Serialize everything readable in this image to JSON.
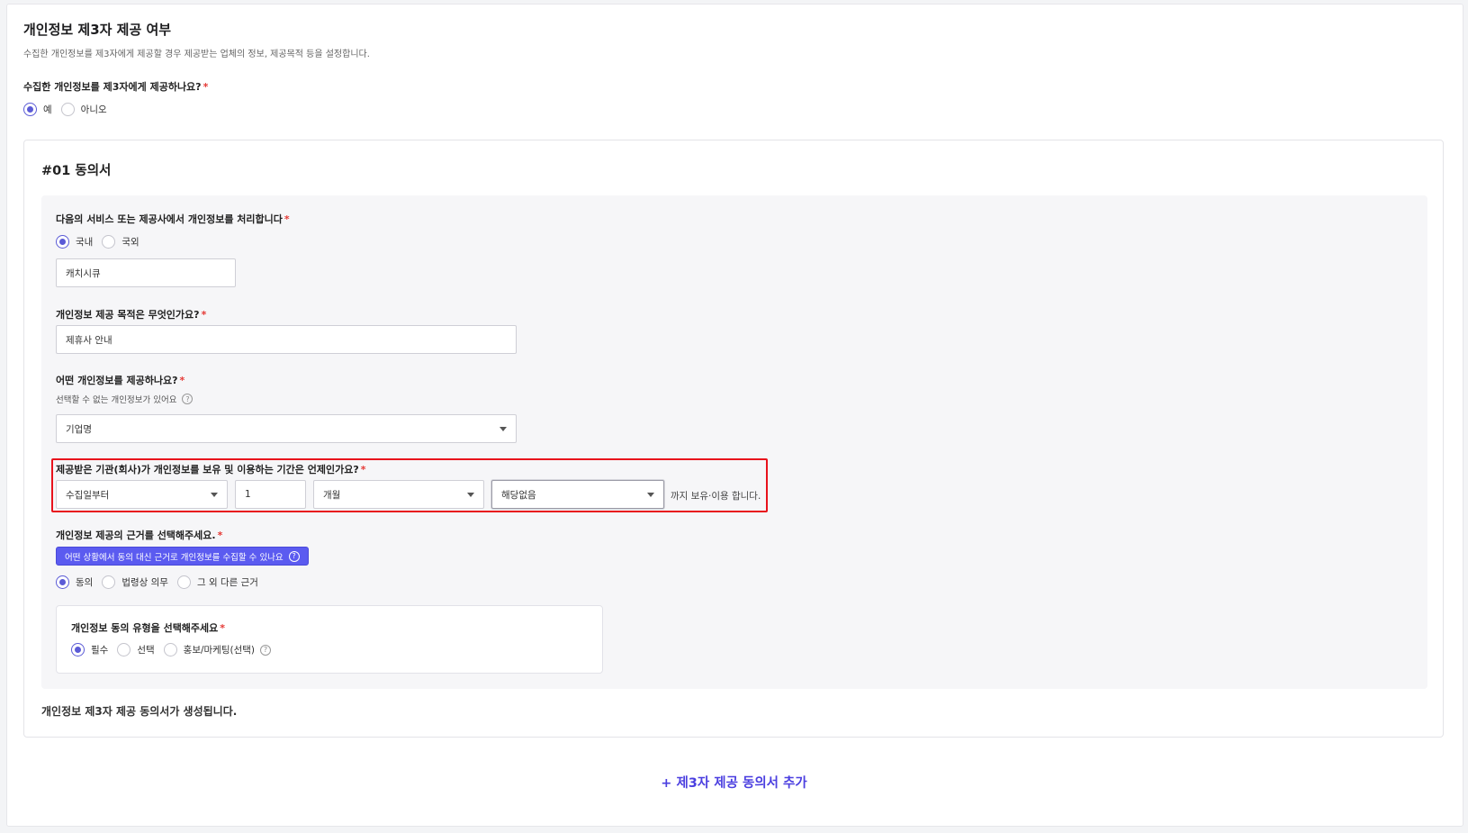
{
  "section": {
    "title": "개인정보 제3자 제공 여부",
    "description": "수집한 개인정보를 제3자에게 제공할 경우 제공받는 업체의 정보, 제공목적 등을 설정합니다."
  },
  "provide_question": {
    "label": "수집한 개인정보를 제3자에게 제공하나요?",
    "required_mark": "*",
    "options": [
      "예",
      "아니오"
    ],
    "selected": "예"
  },
  "consent": {
    "title": "#01 동의서",
    "processor": {
      "label": "다음의 서비스 또는 제공사에서 개인정보를 처리합니다",
      "required_mark": "*",
      "options": [
        "국내",
        "국외"
      ],
      "selected": "국내",
      "value": "캐치시큐"
    },
    "purpose": {
      "label": "개인정보 제공 목적은 무엇인가요?",
      "required_mark": "*",
      "value": "제휴사 안내"
    },
    "items": {
      "label": "어떤 개인정보를 제공하나요?",
      "required_mark": "*",
      "hint": "선택할 수 없는 개인정보가 있어요",
      "hint_icon": "question-circle-icon",
      "value": "기업명"
    },
    "retention": {
      "label": "제공받은 기관(회사)가 개인정보를 보유 및 이용하는 기간은 언제인가요?",
      "required_mark": "*",
      "start": "수집일부터",
      "amount": "1",
      "unit": "개월",
      "exception": "해당없음",
      "suffix": "까지 보유·이용 합니다.",
      "highlight_color": "#e8121c"
    },
    "basis": {
      "label": "개인정보 제공의 근거를 선택해주세요.",
      "required_mark": "*",
      "badge": "어떤 상황에서 동의 대신 근거로 개인정보를 수집할 수 있나요",
      "badge_icon": "question-circle-icon",
      "options": [
        "동의",
        "법령상 의무",
        "그 외 다른 근거"
      ],
      "selected": "동의"
    },
    "consent_type": {
      "label": "개인정보 동의 유형을 선택해주세요",
      "required_mark": "*",
      "options": [
        "필수",
        "선택",
        "홍보/마케팅(선택)"
      ],
      "selected": "필수",
      "help_icon": "question-circle-icon"
    },
    "footer_note": "개인정보 제3자 제공 동의서가 생성됩니다."
  },
  "add_button": "+ 제3자 제공 동의서 추가",
  "colors": {
    "accent": "#5b5bd6",
    "badge_bg": "#5b5bf0",
    "link": "#4b3fe0",
    "required": "#e53935"
  }
}
